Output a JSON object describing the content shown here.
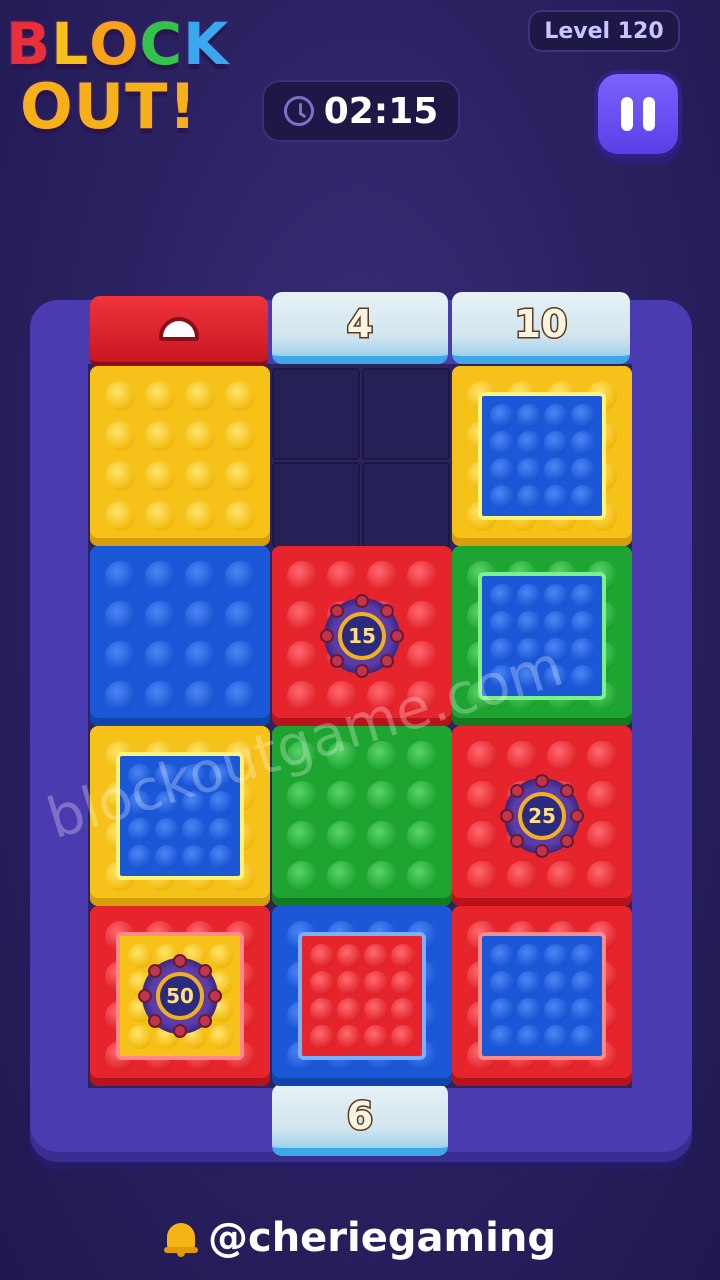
{
  "app": {
    "title_line1": [
      "B",
      "L",
      "O",
      "C",
      "K"
    ],
    "title_line2": [
      "O",
      "U",
      "T",
      "!"
    ],
    "level_label": "Level 120",
    "timer": "02:15",
    "pause_icon": "pause-icon",
    "credit": "@cheriegaming",
    "watermark": "blockoutgame.com"
  },
  "doors": {
    "top_left_arrow": "arrow-up-icon",
    "top_middle": "4",
    "top_right": "10",
    "bottom_middle": "6"
  },
  "bombs": {
    "b1": "15",
    "b2": "25",
    "b3": "50"
  },
  "colors": {
    "yellow": "#f6c21a",
    "blue": "#1b58d8",
    "red": "#e5242c",
    "green": "#1ea431",
    "board": "#4a3bb0",
    "background": "#2a2160"
  }
}
